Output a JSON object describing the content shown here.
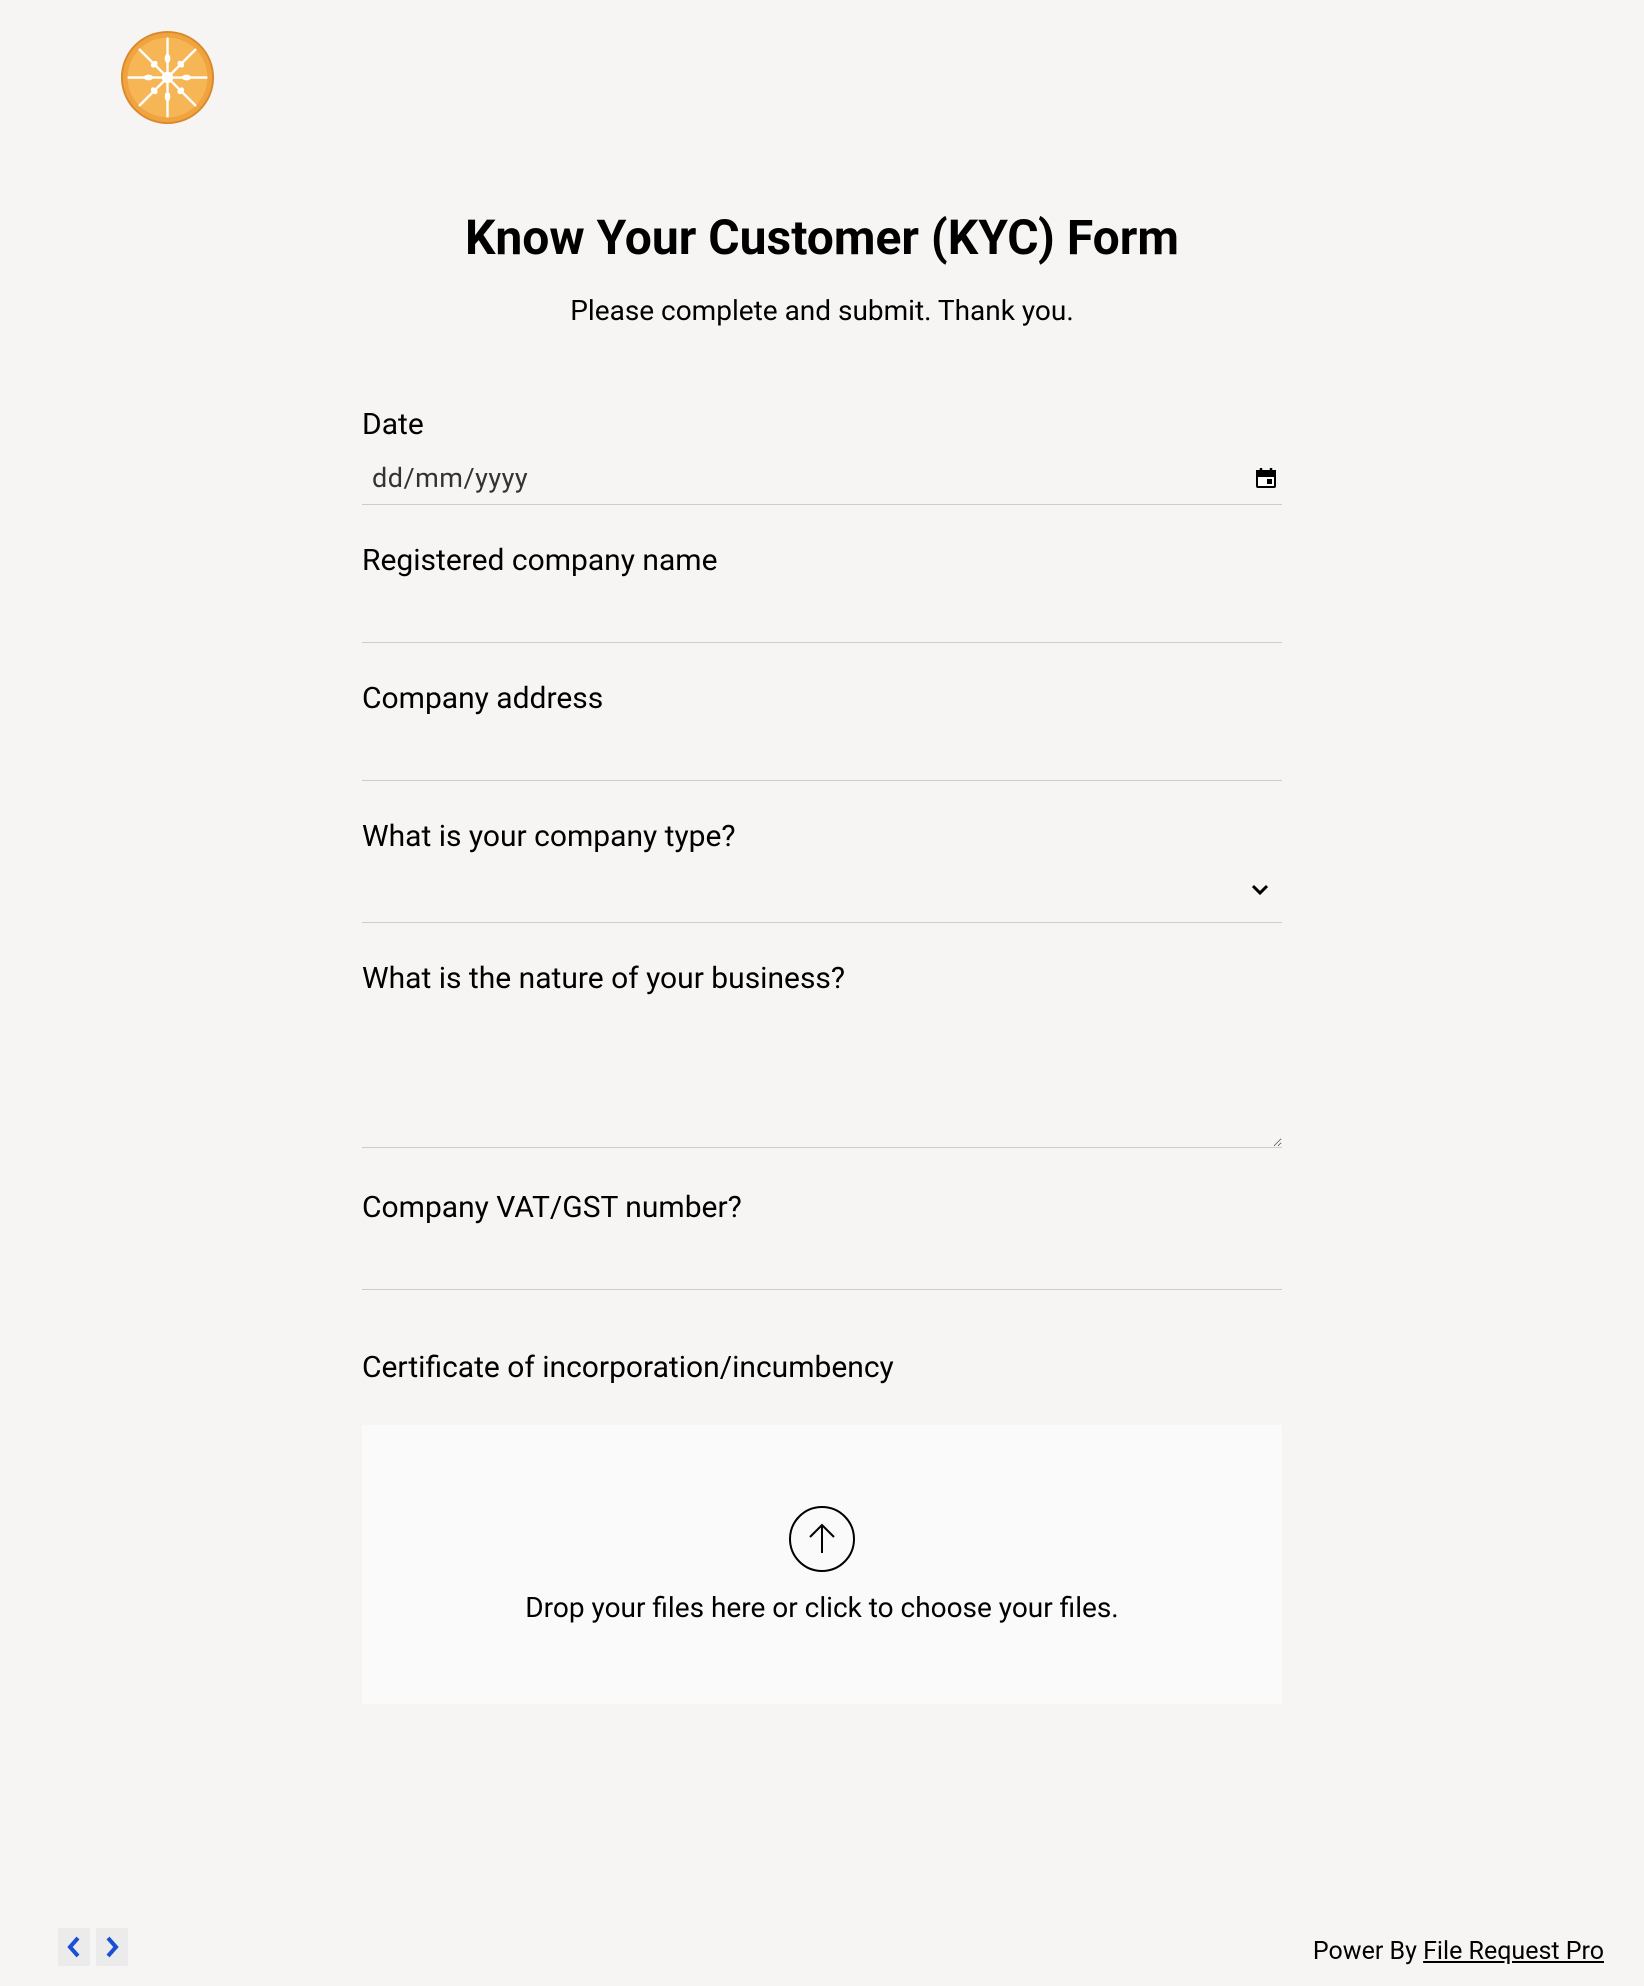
{
  "header": {
    "title": "Know Your Customer (KYC) Form",
    "subtitle": "Please complete and submit. Thank you."
  },
  "fields": {
    "date": {
      "label": "Date",
      "placeholder": "dd/mm/yyyy"
    },
    "companyName": {
      "label": "Registered company name"
    },
    "companyAddress": {
      "label": "Company address"
    },
    "companyType": {
      "label": "What is your company type?"
    },
    "businessNature": {
      "label": "What is the nature of your business?"
    },
    "vatNumber": {
      "label": "Company VAT/GST number?"
    },
    "certificate": {
      "label": "Certificate of incorporation/incumbency",
      "uploadText": "Drop your files here or click to choose your files."
    }
  },
  "footer": {
    "prefix": "Power By ",
    "linkText": "File Request Pro"
  }
}
